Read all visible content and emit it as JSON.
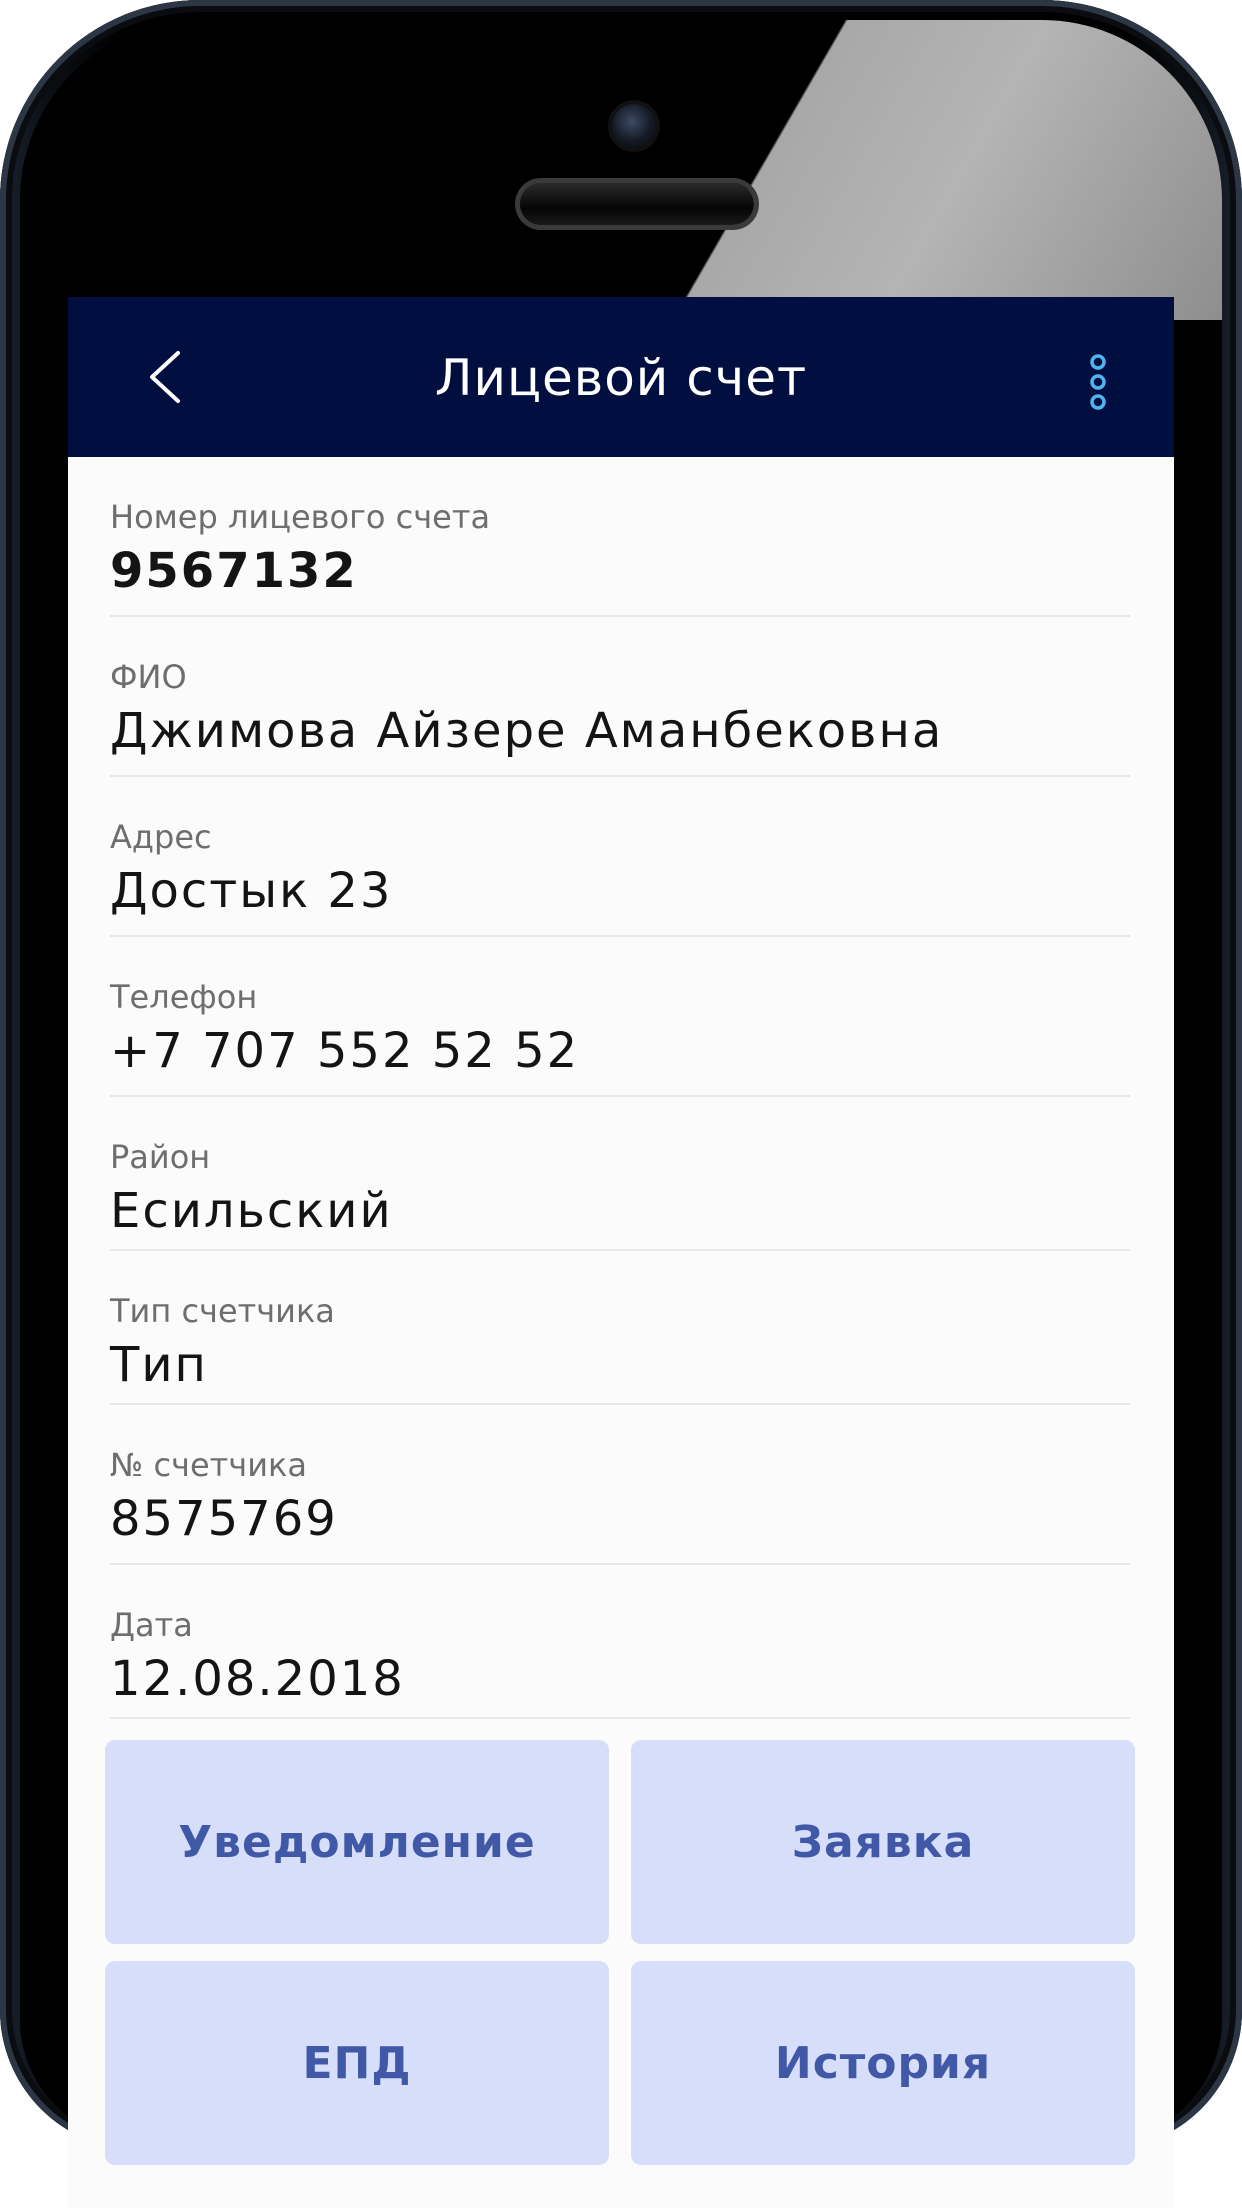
{
  "header": {
    "title": "Лицевой счет",
    "back_icon": "chevron-left-icon",
    "menu_icon": "more-vertical-icon",
    "bar_color": "#000f40",
    "menu_icon_color": "#4fb4ef"
  },
  "fields": [
    {
      "label": "Номер лицевого счета",
      "value": "9567132"
    },
    {
      "label": "ФИО",
      "value": "Джимова Айзере Аманбековна"
    },
    {
      "label": "Адрес",
      "value": "Достык 23"
    },
    {
      "label": "Телефон",
      "value": "+7 707 552 52 52"
    },
    {
      "label": "Район",
      "value": "Есильский"
    },
    {
      "label": "Тип счетчика",
      "value": "Тип"
    },
    {
      "label": "№ счетчика",
      "value": "8575769"
    },
    {
      "label": "Дата",
      "value": "12.08.2018"
    }
  ],
  "actions": {
    "notification": "Уведомление",
    "request": "Заявка",
    "epd": "ЕПД",
    "history": "История",
    "button_color": "#d6defa",
    "text_color": "#4158a6"
  }
}
